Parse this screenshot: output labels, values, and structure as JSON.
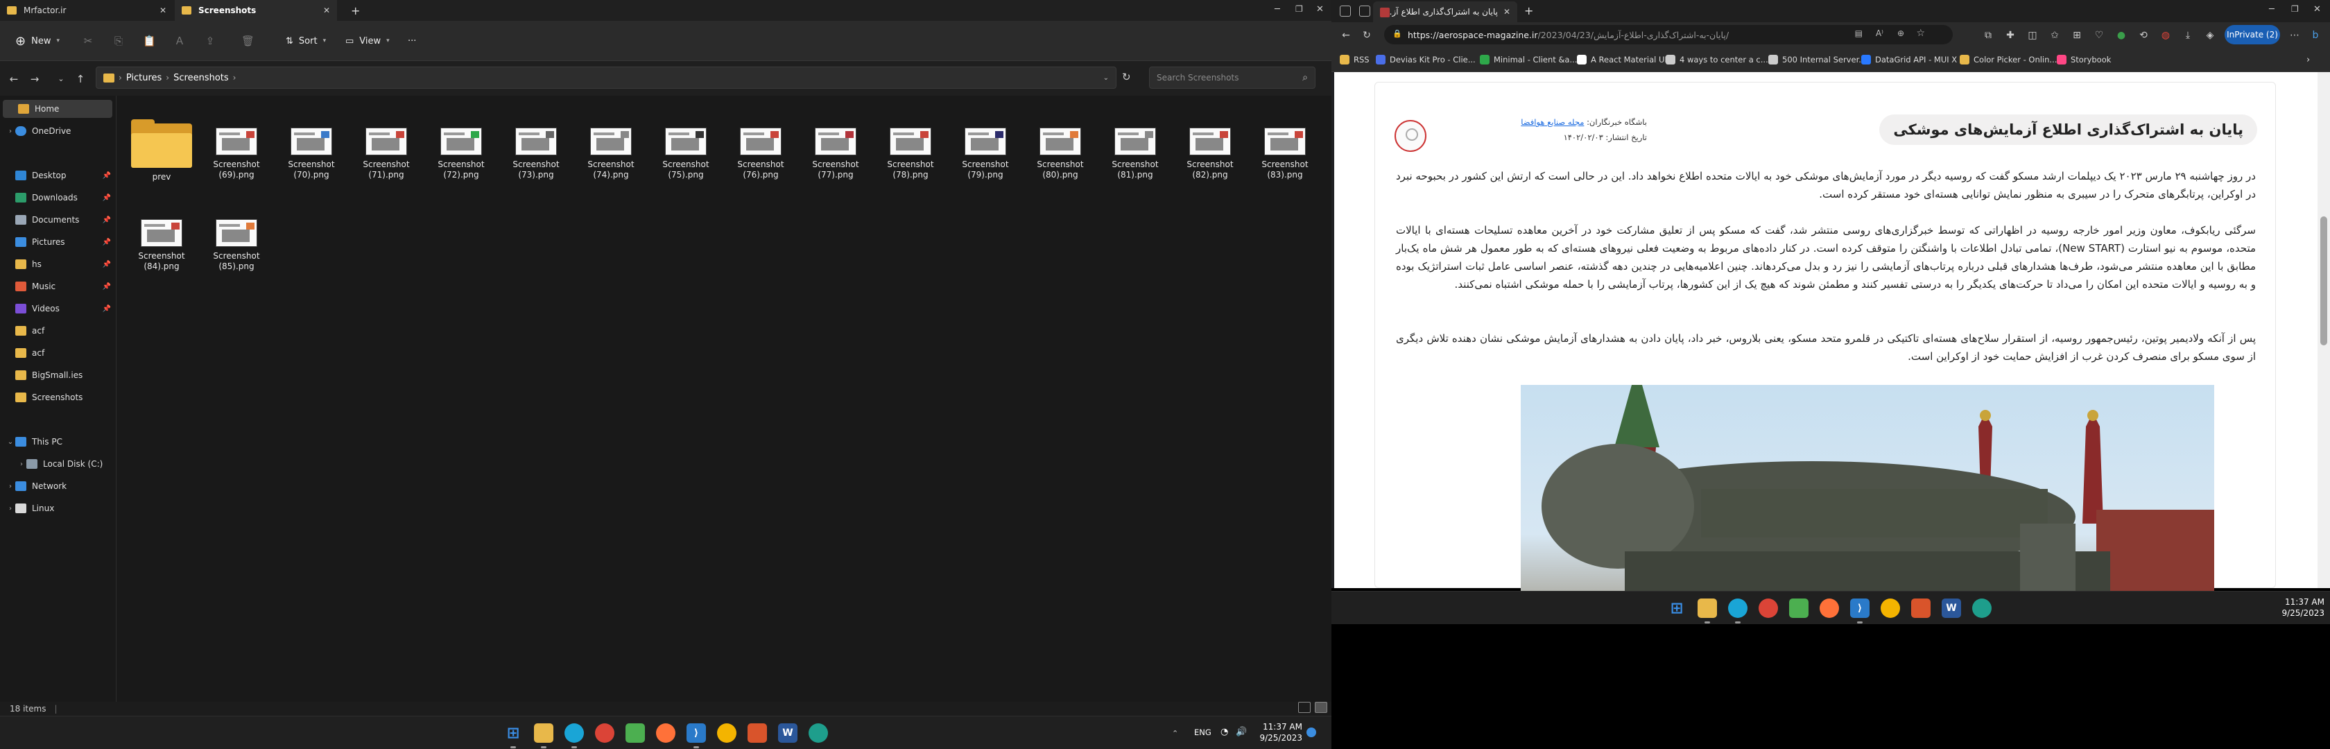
{
  "explorer": {
    "tabs": [
      {
        "label": "Mrfactor.ir"
      },
      {
        "label": "Screenshots"
      }
    ],
    "toolbar": {
      "new_label": "New",
      "sort_label": "Sort",
      "view_label": "View",
      "more_label": "···"
    },
    "breadcrumb": [
      "Pictures",
      "Screenshots"
    ],
    "search_placeholder": "Search Screenshots",
    "nav": {
      "home": "Home",
      "onedrive": "OneDrive",
      "desktop": "Desktop",
      "downloads": "Downloads",
      "documents": "Documents",
      "pictures": "Pictures",
      "hs": "hs",
      "music": "Music",
      "videos": "Videos",
      "acf1": "acf",
      "acf2": "acf",
      "bigsmall": "BigSmall.ies",
      "screenshots": "Screenshots",
      "thispc": "This PC",
      "localdisk": "Local Disk (C:)",
      "network": "Network",
      "linux": "Linux"
    },
    "files": [
      {
        "name": "prev",
        "kind": "folder"
      },
      {
        "name": "Screenshot (69).png"
      },
      {
        "name": "Screenshot (70).png"
      },
      {
        "name": "Screenshot (71).png"
      },
      {
        "name": "Screenshot (72).png"
      },
      {
        "name": "Screenshot (73).png"
      },
      {
        "name": "Screenshot (74).png"
      },
      {
        "name": "Screenshot (75).png"
      },
      {
        "name": "Screenshot (76).png"
      },
      {
        "name": "Screenshot (77).png"
      },
      {
        "name": "Screenshot (78).png"
      },
      {
        "name": "Screenshot (79).png"
      },
      {
        "name": "Screenshot (80).png"
      },
      {
        "name": "Screenshot (81).png"
      },
      {
        "name": "Screenshot (82).png"
      },
      {
        "name": "Screenshot (83).png"
      },
      {
        "name": "Screenshot (84).png"
      },
      {
        "name": "Screenshot (85).png"
      }
    ],
    "status": "18 items"
  },
  "taskbar_left": {
    "lang": "ENG",
    "time": "11:37 AM",
    "date": "9/25/2023"
  },
  "browser": {
    "tab_title": "پایان به اشتراک‌گذاری اطلاع آزمایش...",
    "url_host": "https://aerospace-magazine.ir",
    "url_path": "/2023/04/23/پایان-به-اشتراک‌گذاری-اطلاع-آزمایش/",
    "inprivate": "InPrivate (2)",
    "favorites": [
      {
        "label": "RSS",
        "color": "#e8b84a"
      },
      {
        "label": "Devias Kit Pro - Clie...",
        "color": "#4a6ee8"
      },
      {
        "label": "Minimal - Client &a...",
        "color": "#2ea84a"
      },
      {
        "label": "A React Material UI...",
        "color": "#ffffff"
      },
      {
        "label": "4 ways to center a c...",
        "color": "#cccccc"
      },
      {
        "label": "500 Internal Server...",
        "color": "#cccccc"
      },
      {
        "label": "DataGrid API - MUI X",
        "color": "#2979ff"
      },
      {
        "label": "Color Picker - Onlin...",
        "color": "#e8b84a"
      },
      {
        "label": "Storybook",
        "color": "#ff4785"
      }
    ],
    "article": {
      "title": "پایان به اشتراک‌گذاری اطلاع آزمایش‌های موشکی",
      "club_label": "باشگاه خبرنگاران:",
      "club_link": "مجله صنایع هوافضا",
      "date_label": "تاریخ انتشار: ۱۴۰۲/۰۲/۰۳",
      "p1": "در روز چهاشنبه ۲۹ مارس ۲۰۲۳ یک دیپلمات ارشد مسکو گفت که روسیه دیگر در مورد آزمایش‌های موشکی خود به ایالات متحده اطلاع نخواهد داد. این در حالی است که ارتش این کشور در بحبوحه نبرد در اوکراین، پرتابگرهای متحرک را در سیبری به منظور نمایش توانایی هسته‌ای خود مستقر کرده است.",
      "p2": "سرگئی ریابکوف، معاون وزیر امور خارجه روسیه در اظهاراتی که توسط خبرگزاری‌های روسی منتشر شد، گفت که مسکو پس از تعلیق مشارکت خود در آخرین معاهده تسلیحات هسته‌ای با ایالات متحده، موسوم به نیو استارت (New START)، تمامی تبادل اطلاعات با واشنگتن را متوقف کرده است. در کنار داده‌های مربوط به وضعیت فعلی نیروهای هسته‌ای که به طور معمول هر شش ماه یک‌بار مطابق با این معاهده منتشر می‌شود، طرف‌ها هشدارهای قبلی درباره پرتاب‌های آزمایشی را نیز رد و بدل می‌کردهاند. چنین اعلامیه‌هایی در چندین دهه گذشته، عنصر اساسی عامل ثبات استراتژیک بوده و به روسیه و ایالات متحده این امکان را می‌داد تا حرکت‌های یکدیگر را به درستی تفسیر کنند و مطمئن شوند که هیچ یک از این کشورها، پرتاب آزمایشی را با حمله موشکی اشتباه نمی‌کنند.",
      "p3": "پس از آنکه ولادیمیر پوتین، رئیس‌جمهور روسیه، از استقرار سلاح‌های هسته‌ای تاکتیکی در قلمرو متحد مسکو، یعنی بلاروس، خبر داد، پایان دادن به هشدارهای آزمایش موشکی نشان دهنده تلاش دیگری از سوی مسکو برای منصرف کردن غرب از افزایش حمایت خود از اوکراین است."
    }
  },
  "taskbar_right": {
    "time": "11:37 AM",
    "date": "9/25/2023"
  }
}
